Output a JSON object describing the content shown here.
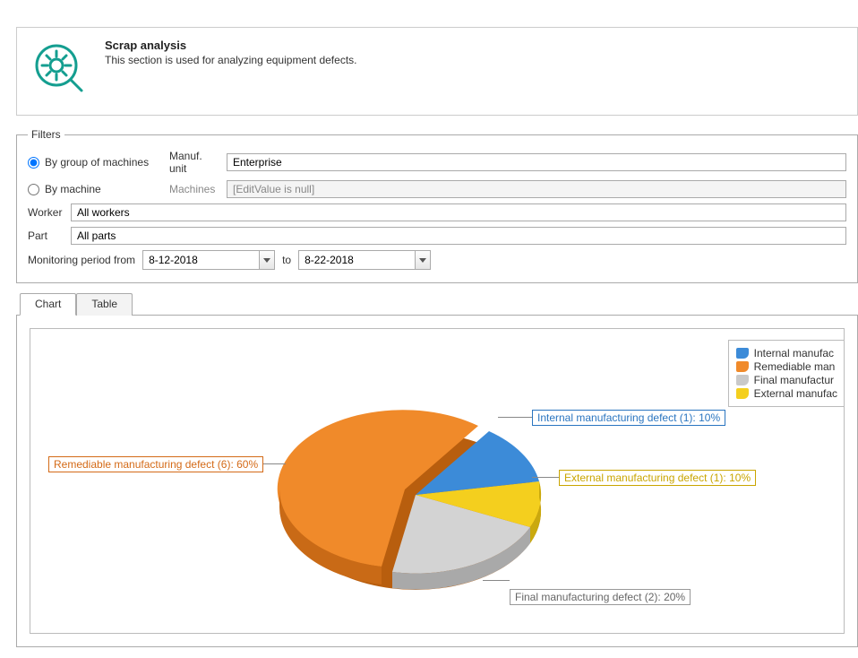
{
  "header": {
    "title": "Scrap analysis",
    "desc": "This section is used for analyzing equipment defects."
  },
  "filters": {
    "legend": "Filters",
    "radio1": "By group of machines",
    "radio2": "By machine",
    "manuf_label": "Manuf. unit",
    "manuf_value": "Enterprise",
    "machines_label": "Machines",
    "machines_value": "[EditValue is null]",
    "worker_label": "Worker",
    "worker_value": "All workers",
    "part_label": "Part",
    "part_value": "All parts",
    "mon_from_label": "Monitoring period from",
    "mon_from": "8-12-2018",
    "mon_to_label": "to",
    "mon_to": "8-22-2018"
  },
  "tabs": {
    "chart": "Chart",
    "table": "Table"
  },
  "legend": {
    "items": [
      {
        "label": "Internal manufac",
        "color": "#3c8bd8"
      },
      {
        "label": "Remediable man",
        "color": "#f08a2a"
      },
      {
        "label": "Final manufactur",
        "color": "#c9c9c9"
      },
      {
        "label": "External manufac",
        "color": "#f4cf1e"
      }
    ]
  },
  "pie_labels": {
    "internal": "Internal manufacturing defect (1): 10%",
    "remediable": "Remediable manufacturing defect (6): 60%",
    "final": "Final manufacturing defect (2): 20%",
    "external": "External manufacturing defect (1): 10%"
  },
  "chart_data": {
    "type": "pie",
    "title": "Scrap analysis",
    "series": [
      {
        "name": "Internal manufacturing defect",
        "count": 1,
        "percent": 10,
        "color": "#3c8bd8"
      },
      {
        "name": "Remediable manufacturing defect",
        "count": 6,
        "percent": 60,
        "color": "#f08a2a"
      },
      {
        "name": "Final manufacturing defect",
        "count": 2,
        "percent": 20,
        "color": "#c9c9c9"
      },
      {
        "name": "External manufacturing defect",
        "count": 1,
        "percent": 10,
        "color": "#f4cf1e"
      }
    ]
  }
}
